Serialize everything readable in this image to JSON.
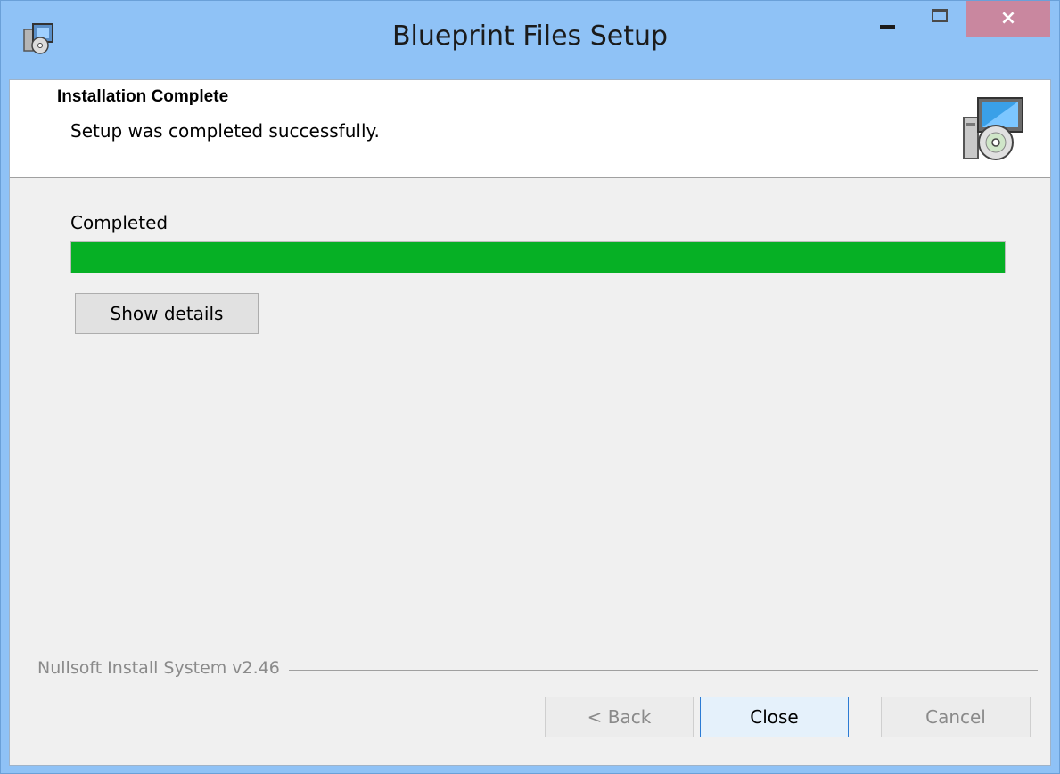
{
  "window": {
    "title": "Blueprint Files Setup",
    "close_glyph": "×"
  },
  "header": {
    "title": "Installation Complete",
    "subtitle": "Setup was completed successfully."
  },
  "progress": {
    "label": "Completed",
    "percent": 100,
    "color": "#06b025"
  },
  "details_button": "Show details",
  "branding": "Nullsoft Install System v2.46",
  "buttons": {
    "back": "< Back",
    "close": "Close",
    "cancel": "Cancel"
  },
  "icons": {
    "app": "installer-icon",
    "header": "installer-computer-cd-icon"
  }
}
